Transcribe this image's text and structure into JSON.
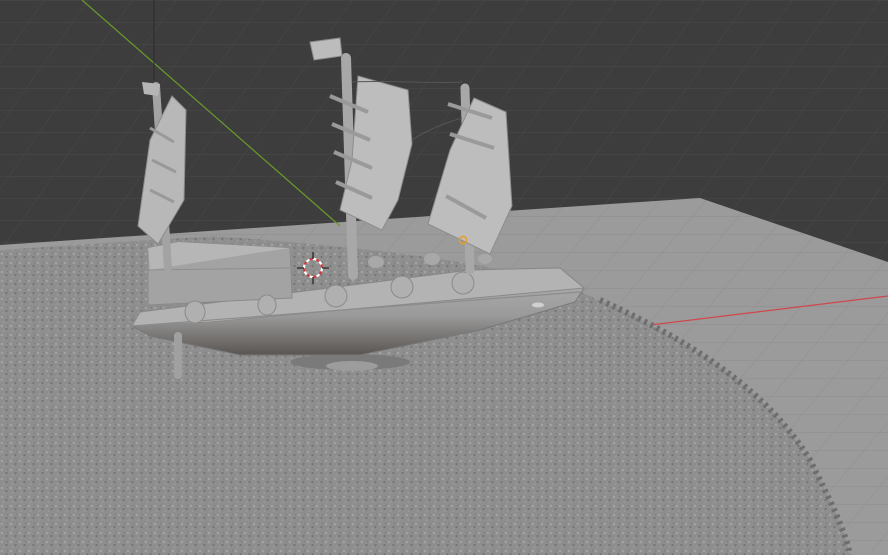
{
  "viewport": {
    "background_color": "#3d3d3d",
    "grid_line_color": "#4a4a4a",
    "ground_plane_color": "#9b9b9b",
    "ground_grid_color": "#8c8c8c",
    "sand_color": "#8a8a8a",
    "x_axis_color": "#d0474c",
    "y_axis_color": "#6a9a2a",
    "model_color": "#a9a9a9",
    "model_shadow_color": "#7a7a7a"
  },
  "objects": {
    "model_name": "ship-model",
    "cursor_icon": "3d-cursor-icon",
    "origin_icon": "object-origin-icon",
    "selection_color": "#e89b2a"
  }
}
